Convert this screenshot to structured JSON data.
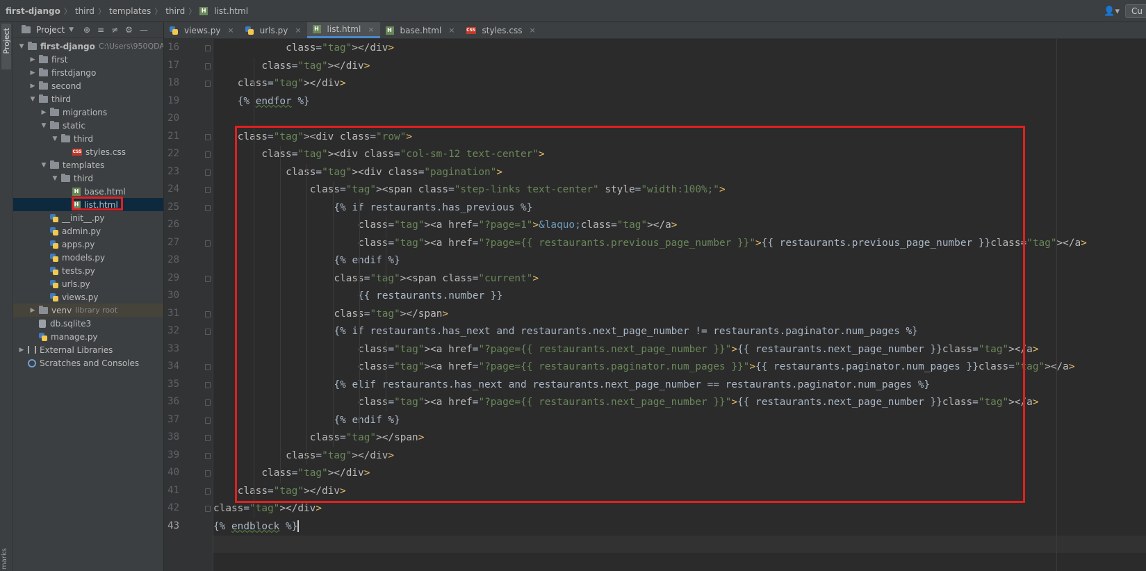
{
  "breadcrumb": [
    "first-django",
    "third",
    "templates",
    "third",
    "list.html"
  ],
  "toolbar_right": {
    "user_icon": "user-icon",
    "cu_label": "Cu"
  },
  "left_strip": {
    "project_label": "Project",
    "bottom_label": "marks"
  },
  "project_panel": {
    "title": "Project",
    "tree": [
      {
        "label": "first-django",
        "hint": "C:\\Users\\950QDA-",
        "type": "folder",
        "depth": 0,
        "expanded": true
      },
      {
        "label": "first",
        "type": "folder",
        "depth": 1,
        "expanded": false
      },
      {
        "label": "firstdjango",
        "type": "folder",
        "depth": 1,
        "expanded": false
      },
      {
        "label": "second",
        "type": "folder",
        "depth": 1,
        "expanded": false
      },
      {
        "label": "third",
        "type": "folder",
        "depth": 1,
        "expanded": true
      },
      {
        "label": "migrations",
        "type": "folder",
        "depth": 2,
        "expanded": false
      },
      {
        "label": "static",
        "type": "folder",
        "depth": 2,
        "expanded": true
      },
      {
        "label": "third",
        "type": "folder",
        "depth": 3,
        "expanded": true
      },
      {
        "label": "styles.css",
        "type": "css",
        "depth": 4
      },
      {
        "label": "templates",
        "type": "folder",
        "depth": 2,
        "expanded": true
      },
      {
        "label": "third",
        "type": "folder",
        "depth": 3,
        "expanded": true
      },
      {
        "label": "base.html",
        "type": "html",
        "depth": 4
      },
      {
        "label": "list.html",
        "type": "html",
        "depth": 4,
        "selected": true
      },
      {
        "label": "__init__.py",
        "type": "py",
        "depth": 2
      },
      {
        "label": "admin.py",
        "type": "py",
        "depth": 2
      },
      {
        "label": "apps.py",
        "type": "py",
        "depth": 2
      },
      {
        "label": "models.py",
        "type": "py",
        "depth": 2
      },
      {
        "label": "tests.py",
        "type": "py",
        "depth": 2
      },
      {
        "label": "urls.py",
        "type": "py",
        "depth": 2
      },
      {
        "label": "views.py",
        "type": "py",
        "depth": 2
      },
      {
        "label": "venv",
        "hint": "library root",
        "type": "folder",
        "depth": 1,
        "expanded": false
      },
      {
        "label": "db.sqlite3",
        "type": "db",
        "depth": 1
      },
      {
        "label": "manage.py",
        "type": "py",
        "depth": 1
      },
      {
        "label": "External Libraries",
        "type": "lib",
        "depth": 0,
        "expanded": false
      },
      {
        "label": "Scratches and Consoles",
        "type": "scratch",
        "depth": 0
      }
    ]
  },
  "tabs": [
    {
      "label": "views.py",
      "type": "py"
    },
    {
      "label": "urls.py",
      "type": "py"
    },
    {
      "label": "list.html",
      "type": "html",
      "active": true
    },
    {
      "label": "base.html",
      "type": "html"
    },
    {
      "label": "styles.css",
      "type": "css"
    }
  ],
  "editor": {
    "first_line": 16,
    "current_line": 43,
    "lines": [
      "            </div>",
      "        </div>",
      "    </div>",
      "    {% endfor %}",
      "",
      "    <div class=\"row\">",
      "        <div class=\"col-sm-12 text-center\">",
      "            <div class=\"pagination\">",
      "                <span class=\"step-links text-center\" style=\"width:100%;\">",
      "                    {% if restaurants.has_previous %}",
      "                        <a href=\"?page=1\">&laquo;</a>",
      "                        <a href=\"?page={{ restaurants.previous_page_number }}\">{{ restaurants.previous_page_number }}</a>",
      "                    {% endif %}",
      "                    <span class=\"current\">",
      "                        {{ restaurants.number }}",
      "                    </span>",
      "                    {% if restaurants.has_next and restaurants.next_page_number != restaurants.paginator.num_pages %}",
      "                        <a href=\"?page={{ restaurants.next_page_number }}\">{{ restaurants.next_page_number }}</a>",
      "                        <a href=\"?page={{ restaurants.paginator.num_pages }}\">{{ restaurants.paginator.num_pages }}</a>",
      "                    {% elif restaurants.has_next and restaurants.next_page_number == restaurants.paginator.num_pages %}",
      "                        <a href=\"?page={{ restaurants.next_page_number }}\">{{ restaurants.next_page_number }}</a>",
      "                    {% endif %}",
      "                </span>",
      "            </div>",
      "        </div>",
      "    </div>",
      "</div>",
      "{% endblock %}"
    ]
  },
  "colors": {
    "tag": "#e8bf6a",
    "attr_value": "#6a8759",
    "text": "#a9b7c6",
    "annotation_box": "#e02020",
    "active_tab_underline": "#4a88c7"
  }
}
